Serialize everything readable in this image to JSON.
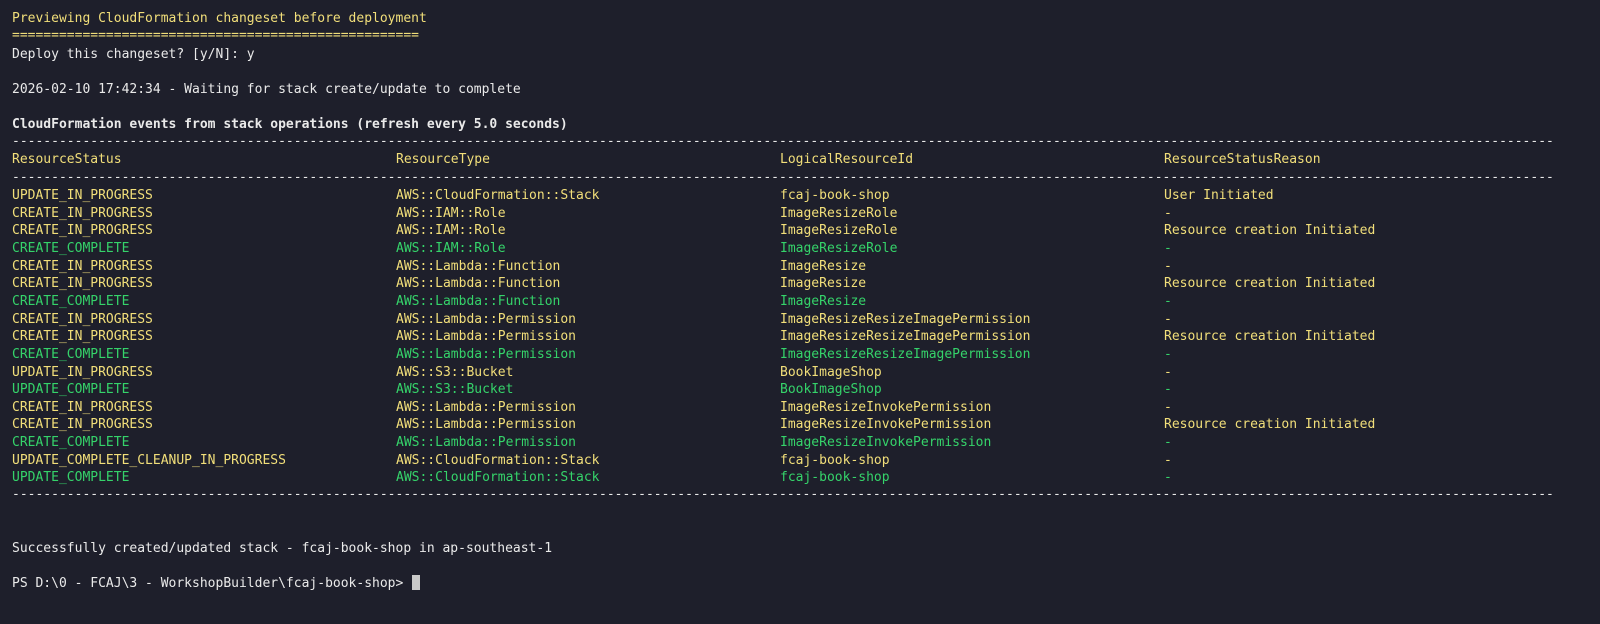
{
  "header": {
    "preview_title": "Previewing CloudFormation changeset before deployment",
    "preview_underline": "====================================================",
    "deploy_prompt": "Deploy this changeset? [y/N]: y",
    "waiting": "2026-02-10 17:42:34 - Waiting for stack create/update to complete",
    "events_title": "CloudFormation events from stack operations (refresh every 5.0 seconds)"
  },
  "rules": {
    "dash_line": "------------------------------------------------------------------------------------------------------------------------------------------------------------------------------------------------------------------------------------------------------------------"
  },
  "table": {
    "columns": [
      "ResourceStatus",
      "ResourceType",
      "LogicalResourceId",
      "ResourceStatusReason"
    ],
    "rows": [
      {
        "status": "UPDATE_IN_PROGRESS",
        "type": "AWS::CloudFormation::Stack",
        "id": "fcaj-book-shop",
        "reason": "User Initiated",
        "color": "yellow"
      },
      {
        "status": "CREATE_IN_PROGRESS",
        "type": "AWS::IAM::Role",
        "id": "ImageResizeRole",
        "reason": "-",
        "color": "yellow"
      },
      {
        "status": "CREATE_IN_PROGRESS",
        "type": "AWS::IAM::Role",
        "id": "ImageResizeRole",
        "reason": "Resource creation Initiated",
        "color": "yellow"
      },
      {
        "status": "CREATE_COMPLETE",
        "type": "AWS::IAM::Role",
        "id": "ImageResizeRole",
        "reason": "-",
        "color": "green"
      },
      {
        "status": "CREATE_IN_PROGRESS",
        "type": "AWS::Lambda::Function",
        "id": "ImageResize",
        "reason": "-",
        "color": "yellow"
      },
      {
        "status": "CREATE_IN_PROGRESS",
        "type": "AWS::Lambda::Function",
        "id": "ImageResize",
        "reason": "Resource creation Initiated",
        "color": "yellow"
      },
      {
        "status": "CREATE_COMPLETE",
        "type": "AWS::Lambda::Function",
        "id": "ImageResize",
        "reason": "-",
        "color": "green"
      },
      {
        "status": "CREATE_IN_PROGRESS",
        "type": "AWS::Lambda::Permission",
        "id": "ImageResizeResizeImagePermission",
        "reason": "-",
        "color": "yellow"
      },
      {
        "status": "CREATE_IN_PROGRESS",
        "type": "AWS::Lambda::Permission",
        "id": "ImageResizeResizeImagePermission",
        "reason": "Resource creation Initiated",
        "color": "yellow"
      },
      {
        "status": "CREATE_COMPLETE",
        "type": "AWS::Lambda::Permission",
        "id": "ImageResizeResizeImagePermission",
        "reason": "-",
        "color": "green"
      },
      {
        "status": "UPDATE_IN_PROGRESS",
        "type": "AWS::S3::Bucket",
        "id": "BookImageShop",
        "reason": "-",
        "color": "yellow"
      },
      {
        "status": "UPDATE_COMPLETE",
        "type": "AWS::S3::Bucket",
        "id": "BookImageShop",
        "reason": "-",
        "color": "green"
      },
      {
        "status": "CREATE_IN_PROGRESS",
        "type": "AWS::Lambda::Permission",
        "id": "ImageResizeInvokePermission",
        "reason": "-",
        "color": "yellow"
      },
      {
        "status": "CREATE_IN_PROGRESS",
        "type": "AWS::Lambda::Permission",
        "id": "ImageResizeInvokePermission",
        "reason": "Resource creation Initiated",
        "color": "yellow"
      },
      {
        "status": "CREATE_COMPLETE",
        "type": "AWS::Lambda::Permission",
        "id": "ImageResizeInvokePermission",
        "reason": "-",
        "color": "green"
      },
      {
        "status": "UPDATE_COMPLETE_CLEANUP_IN_PROGRESS",
        "type": "AWS::CloudFormation::Stack",
        "id": "fcaj-book-shop",
        "reason": "-",
        "color": "yellow"
      },
      {
        "status": "UPDATE_COMPLETE",
        "type": "AWS::CloudFormation::Stack",
        "id": "fcaj-book-shop",
        "reason": "-",
        "color": "green"
      }
    ]
  },
  "footer": {
    "success": "Successfully created/updated stack - fcaj-book-shop in ap-southeast-1",
    "prompt": "PS D:\\0 - FCAJ\\3 - WorkshopBuilder\\fcaj-book-shop> "
  },
  "colors": {
    "background": "#1e1f2b",
    "yellow": "#f2df7a",
    "green": "#35d36a",
    "white": "#eaeaea"
  }
}
